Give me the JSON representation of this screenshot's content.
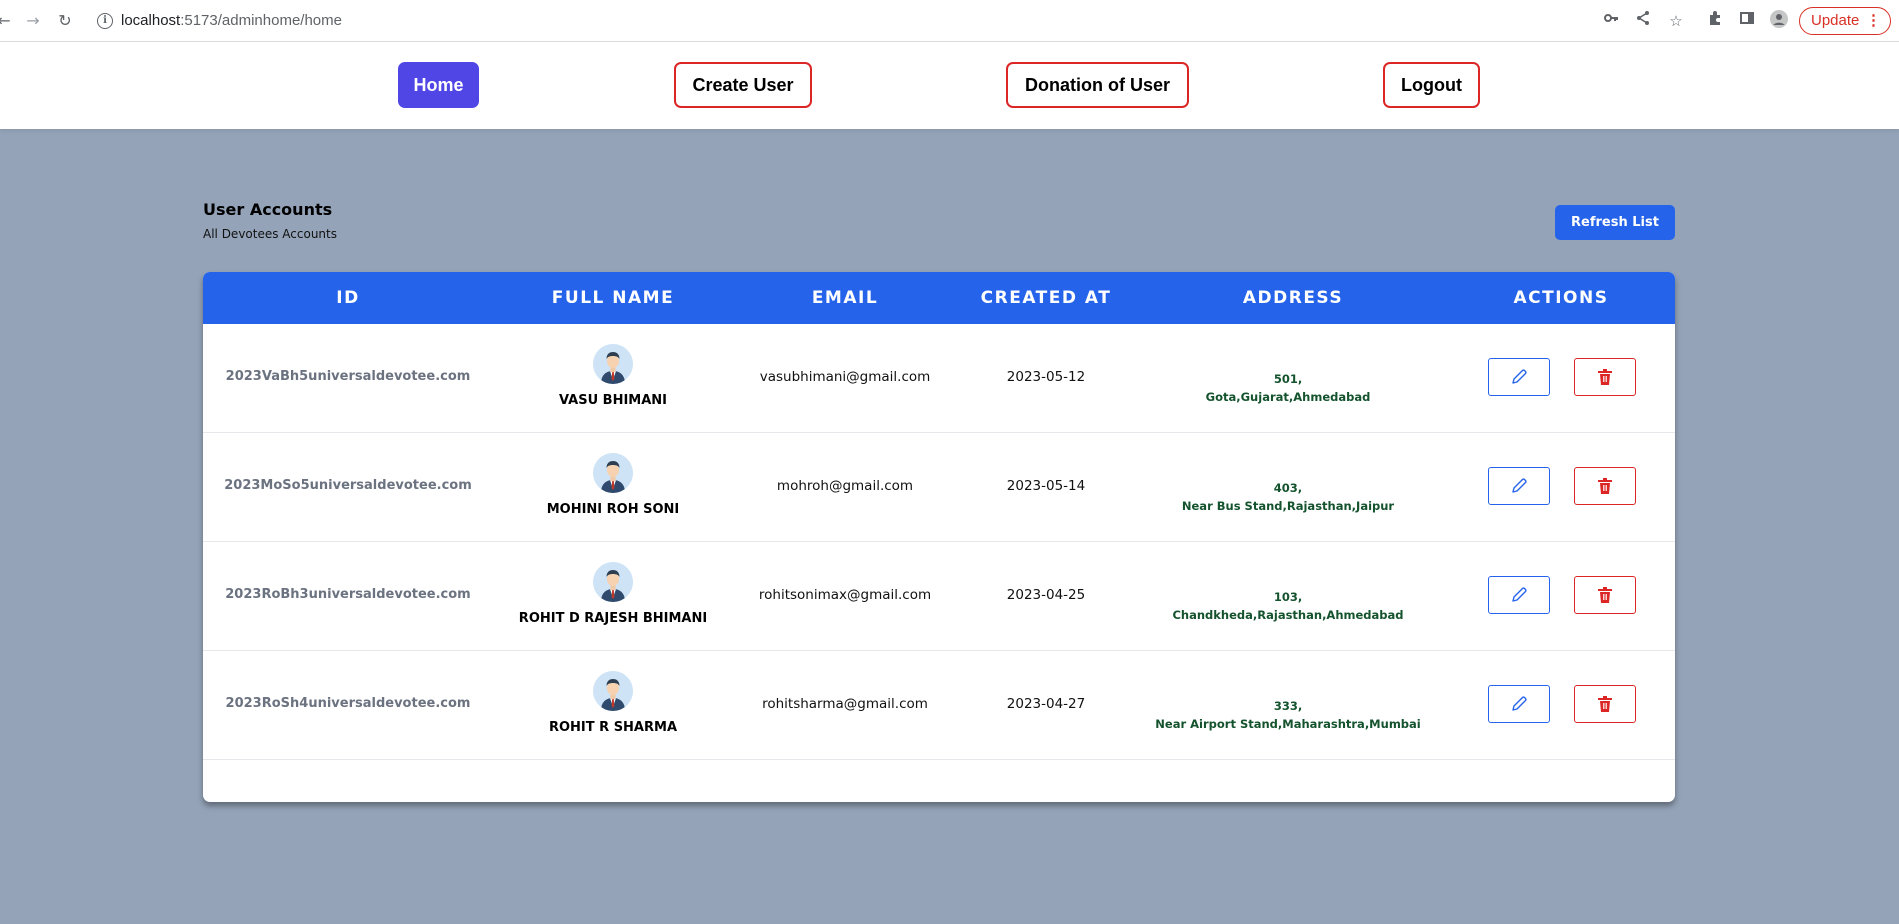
{
  "browser": {
    "url_host": "localhost",
    "url_path": ":5173/adminhome/home",
    "update_label": "Update"
  },
  "nav": {
    "home": "Home",
    "create_user": "Create User",
    "donation": "Donation of User",
    "logout": "Logout"
  },
  "page": {
    "title": "User Accounts",
    "subtitle": "All Devotees Accounts",
    "refresh_label": "Refresh List"
  },
  "table": {
    "headers": [
      "ID",
      "FULL NAME",
      "EMAIL",
      "CREATED AT",
      "ADDRESS",
      "ACTIONS"
    ],
    "rows": [
      {
        "id": "2023VaBh5universaldevotee.com",
        "name": "VASU BHIMANI",
        "email": "vasubhimani@gmail.com",
        "created": "2023-05-12",
        "addr1": "501,",
        "addr2": "Gota,Gujarat,Ahmedabad"
      },
      {
        "id": "2023MoSo5universaldevotee.com",
        "name": "MOHINI ROH SONI",
        "email": "mohroh@gmail.com",
        "created": "2023-05-14",
        "addr1": "403,",
        "addr2": "Near Bus Stand,Rajasthan,Jaipur"
      },
      {
        "id": "2023RoBh3universaldevotee.com",
        "name": "ROHIT D RAJESH BHIMANI",
        "email": "rohitsonimax@gmail.com",
        "created": "2023-04-25",
        "addr1": "103,",
        "addr2": "Chandkheda,Rajasthan,Ahmedabad"
      },
      {
        "id": "2023RoSh4universaldevotee.com",
        "name": "ROHIT R SHARMA",
        "email": "rohitsharma@gmail.com",
        "created": "2023-04-27",
        "addr1": "333,",
        "addr2": "Near Airport Stand,Maharashtra,Mumbai"
      }
    ]
  },
  "colors": {
    "background": "#94a3b8",
    "primary": "#2563eb",
    "nav_active": "#4f46e5",
    "danger": "#dc2626",
    "address_text": "#14532d"
  },
  "icons": [
    "back-icon",
    "forward-icon",
    "reload-icon",
    "info-icon",
    "key-icon",
    "share-icon",
    "star-icon",
    "extensions-icon",
    "side-panel-icon",
    "profile-icon",
    "avatar-icon",
    "edit-icon",
    "trash-icon"
  ]
}
